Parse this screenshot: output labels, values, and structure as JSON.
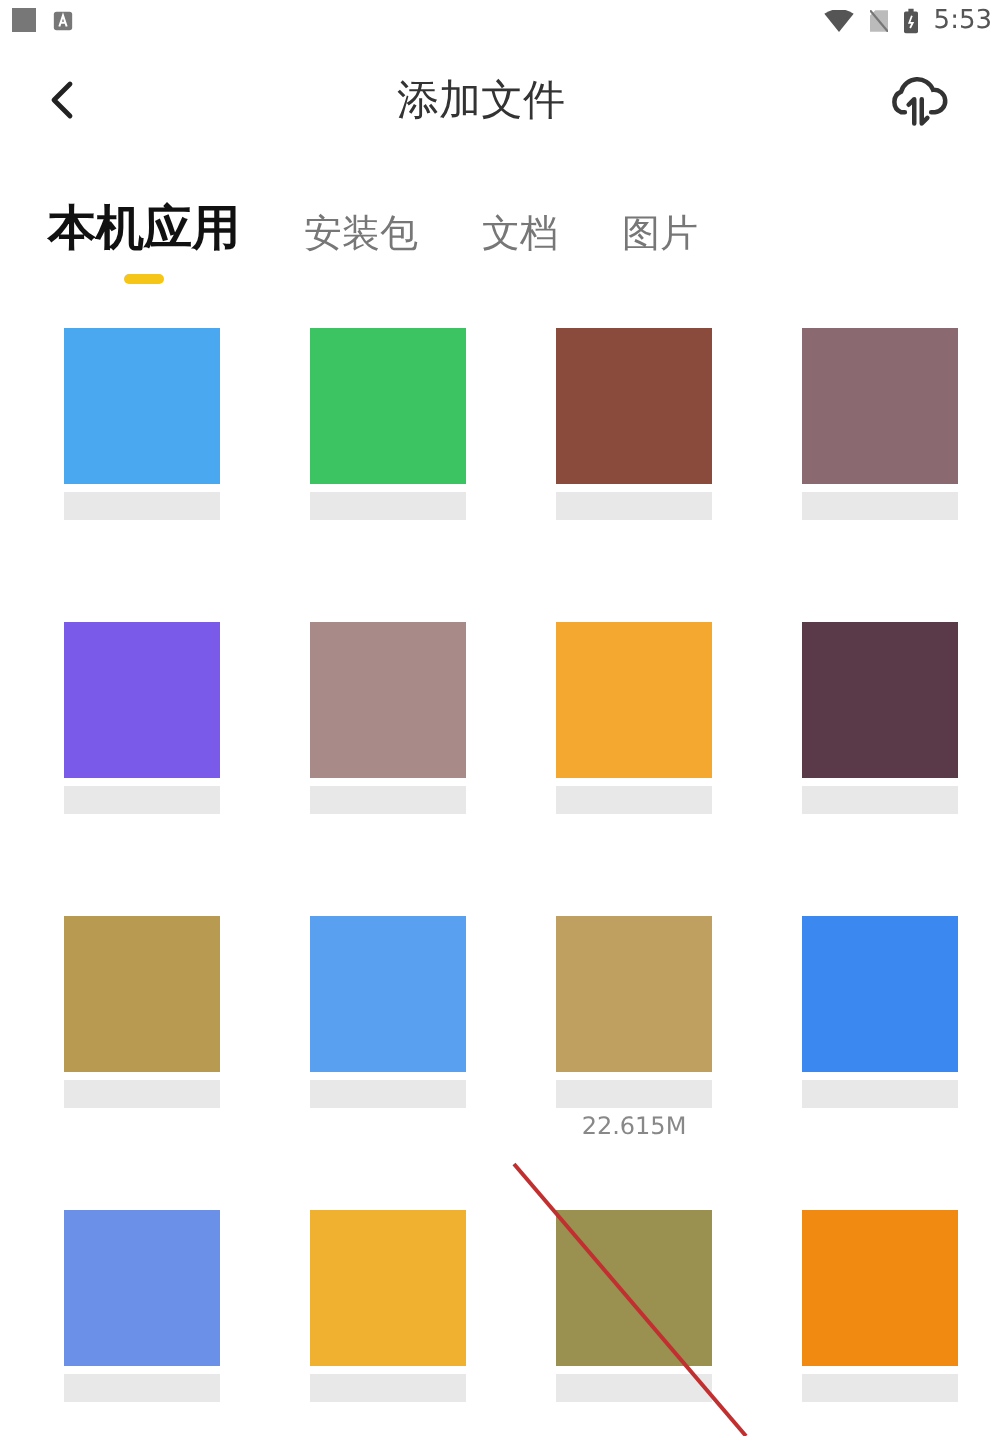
{
  "status_bar": {
    "time": "5:53"
  },
  "header": {
    "title": "添加文件"
  },
  "tabs": [
    {
      "label": "本机应用",
      "selected": true
    },
    {
      "label": "安装包",
      "selected": false
    },
    {
      "label": "文档",
      "selected": false
    },
    {
      "label": "图片",
      "selected": false
    }
  ],
  "apps": [
    {
      "color": "#4aa8f0"
    },
    {
      "color": "#3cc463"
    },
    {
      "color": "#8a4a3c"
    },
    {
      "color": "#8a6a70"
    },
    {
      "color": "#7a5ae8"
    },
    {
      "color": "#a88a88"
    },
    {
      "color": "#f4a830"
    },
    {
      "color": "#5a3a48"
    },
    {
      "color": "#b89a50"
    },
    {
      "color": "#5aa0f0"
    },
    {
      "color": "#c0a060",
      "caption": "22.615M"
    },
    {
      "color": "#3a88f0"
    },
    {
      "color": "#6a90e8"
    },
    {
      "color": "#f0b030"
    },
    {
      "color": "#9a9050"
    },
    {
      "color": "#f08a10"
    }
  ]
}
